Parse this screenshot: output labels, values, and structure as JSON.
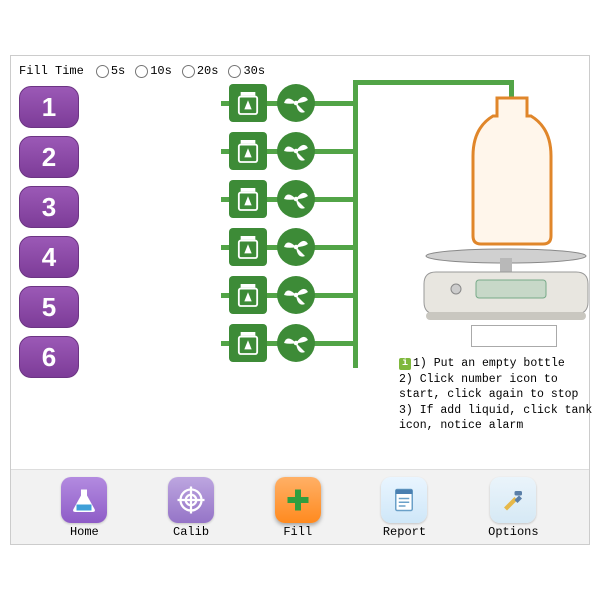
{
  "fillTime": {
    "label": "Fill Time",
    "options": [
      "5s",
      "10s",
      "20s",
      "30s"
    ],
    "selected": null
  },
  "channels": [
    "1",
    "2",
    "3",
    "4",
    "5",
    "6"
  ],
  "weightDisplay": "",
  "instructions": {
    "line1": "1) Put an empty bottle",
    "line2": "2) Click number icon to start, click again to stop",
    "line3": "3) If add liquid, click tank icon, notice alarm"
  },
  "nav": {
    "home": {
      "label": "Home"
    },
    "calib": {
      "label": "Calib"
    },
    "fill": {
      "label": "Fill"
    },
    "report": {
      "label": "Report"
    },
    "options": {
      "label": "Options"
    }
  }
}
